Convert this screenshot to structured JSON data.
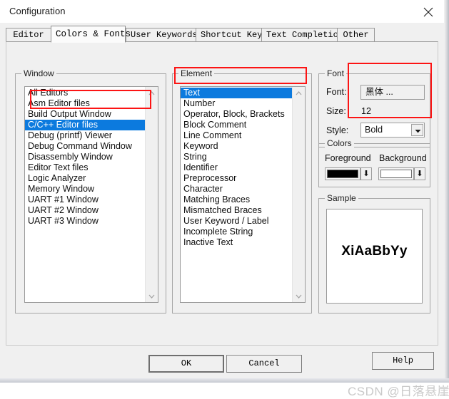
{
  "window": {
    "title": "Configuration",
    "close_icon": "close-icon"
  },
  "tabs": [
    {
      "label": "Editor",
      "active": false
    },
    {
      "label": "Colors & Fonts",
      "active": true
    },
    {
      "label": "User Keywords",
      "active": false
    },
    {
      "label": "Shortcut Keys",
      "active": false
    },
    {
      "label": "Text Completion",
      "active": false
    },
    {
      "label": "Other",
      "active": false
    }
  ],
  "window_group": {
    "title": "Window",
    "items": [
      {
        "label": "All Editors",
        "selected": false
      },
      {
        "label": "Asm Editor files",
        "selected": false
      },
      {
        "label": "Build Output Window",
        "selected": false
      },
      {
        "label": "C/C++ Editor files",
        "selected": true
      },
      {
        "label": "Debug (printf) Viewer",
        "selected": false
      },
      {
        "label": "Debug Command Window",
        "selected": false
      },
      {
        "label": "Disassembly Window",
        "selected": false
      },
      {
        "label": "Editor Text files",
        "selected": false
      },
      {
        "label": "Logic Analyzer",
        "selected": false
      },
      {
        "label": "Memory Window",
        "selected": false
      },
      {
        "label": "UART #1 Window",
        "selected": false
      },
      {
        "label": "UART #2 Window",
        "selected": false
      },
      {
        "label": "UART #3 Window",
        "selected": false
      }
    ]
  },
  "element_group": {
    "title": "Element",
    "items": [
      {
        "label": "Text",
        "selected": true
      },
      {
        "label": "Number",
        "selected": false
      },
      {
        "label": "Operator, Block, Brackets",
        "selected": false
      },
      {
        "label": "Block Comment",
        "selected": false
      },
      {
        "label": "Line Comment",
        "selected": false
      },
      {
        "label": "Keyword",
        "selected": false
      },
      {
        "label": "String",
        "selected": false
      },
      {
        "label": "Identifier",
        "selected": false
      },
      {
        "label": "Preprocessor",
        "selected": false
      },
      {
        "label": "Character",
        "selected": false
      },
      {
        "label": "Matching Braces",
        "selected": false
      },
      {
        "label": "Mismatched Braces",
        "selected": false
      },
      {
        "label": "User Keyword / Label",
        "selected": false
      },
      {
        "label": "Incomplete String",
        "selected": false
      },
      {
        "label": "Inactive Text",
        "selected": false
      }
    ]
  },
  "font_group": {
    "title": "Font",
    "font_label": "Font:",
    "font_value": "黑体 ...",
    "size_label": "Size:",
    "size_value": "12",
    "style_label": "Style:",
    "style_value": "Bold"
  },
  "colors_group": {
    "title": "Colors",
    "foreground_label": "Foreground",
    "background_label": "Background",
    "foreground_color": "#000000",
    "background_color": "#ffffff",
    "dropdown_glyph": "⬇"
  },
  "sample_group": {
    "title": "Sample",
    "text": "XiAaBbYy"
  },
  "buttons": {
    "ok": "OK",
    "cancel": "Cancel",
    "help": "Help"
  },
  "watermark": "CSDN @日落悬崖",
  "annotation_color": "#fc1414"
}
